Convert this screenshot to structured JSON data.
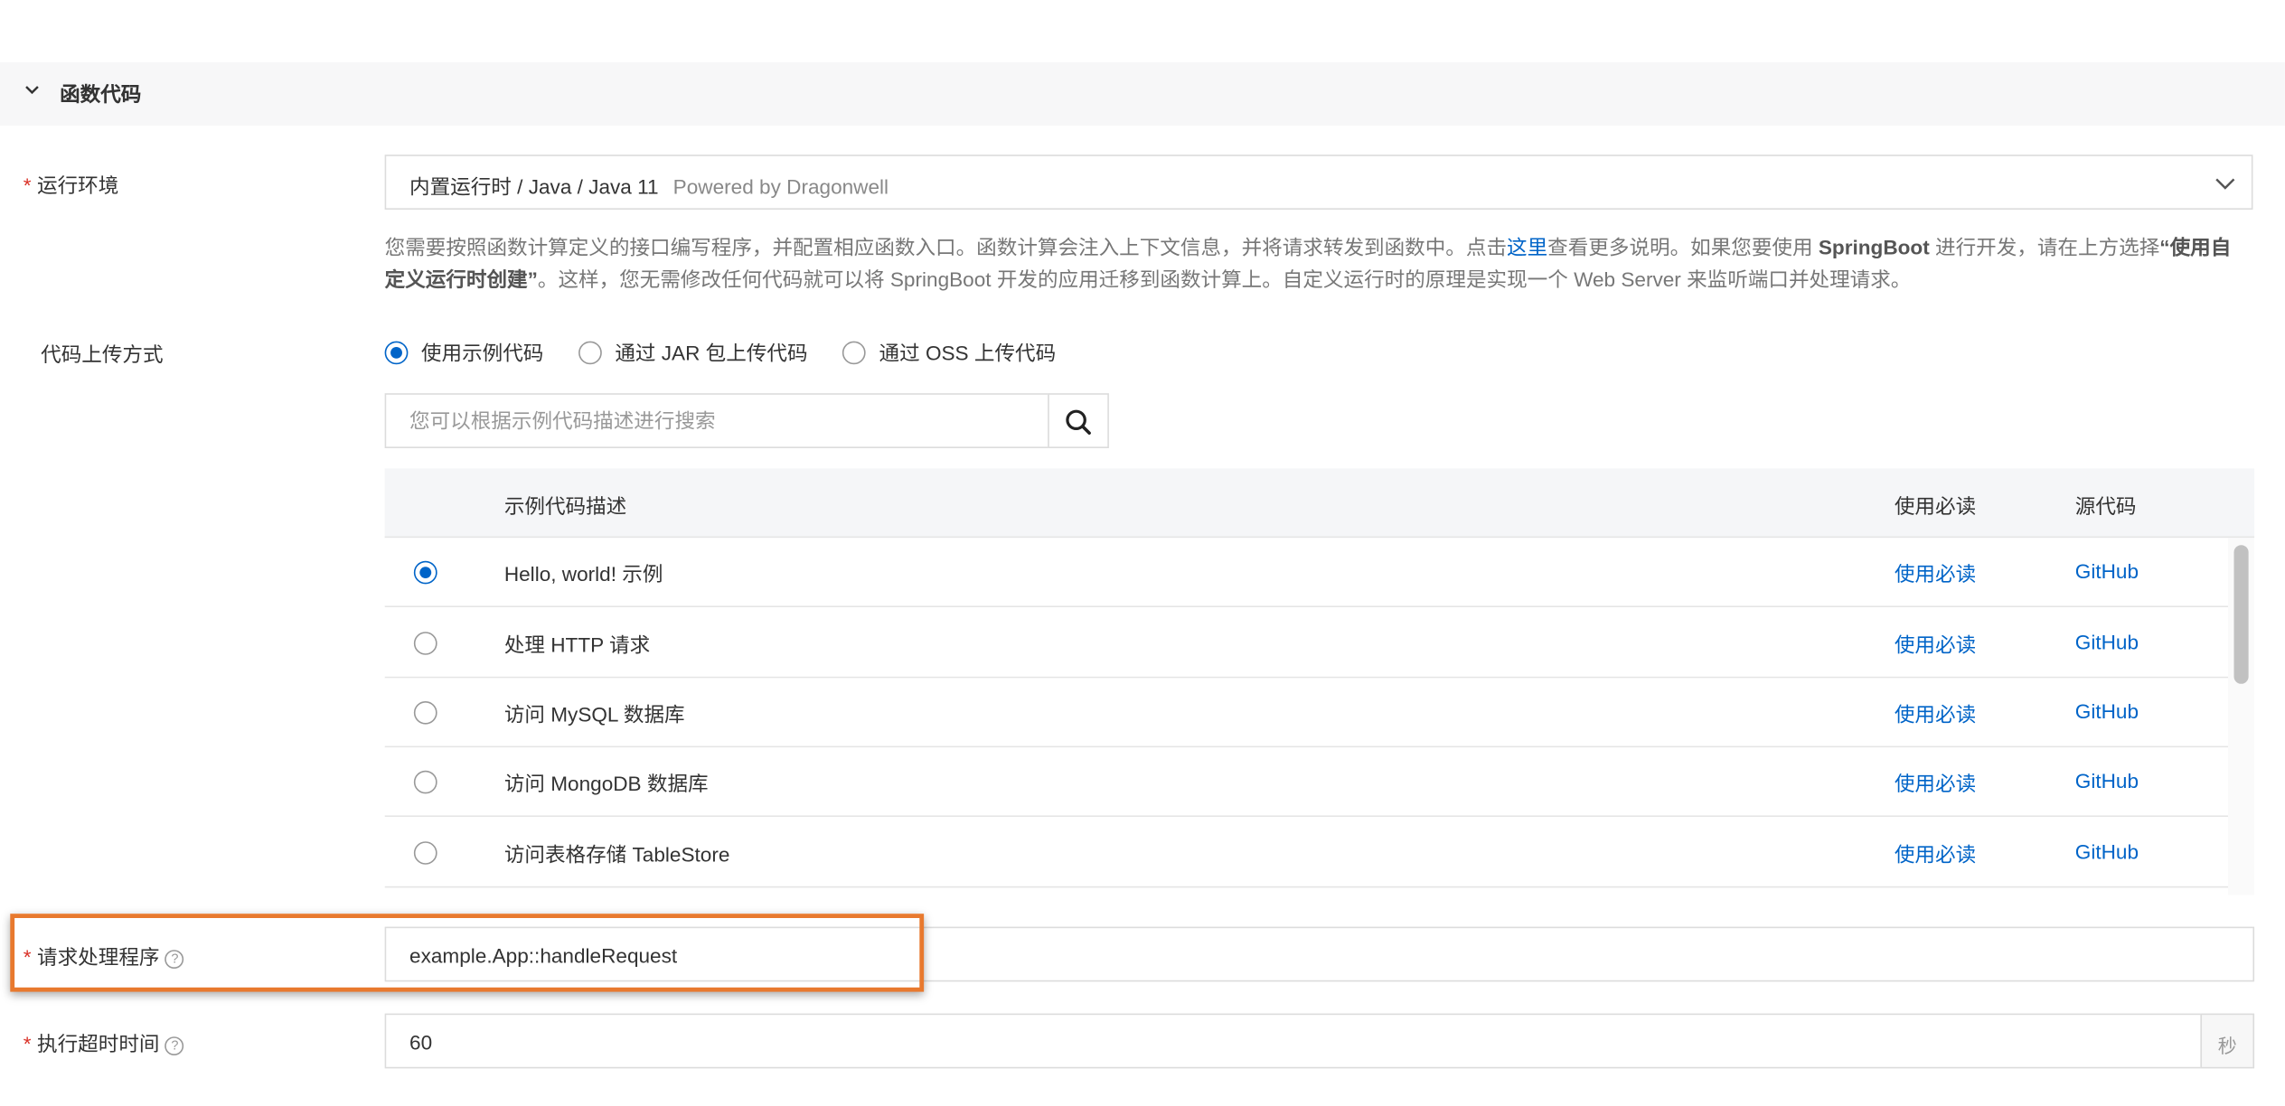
{
  "section": {
    "title": "函数代码",
    "collapse_icon": "chevron-down-icon"
  },
  "runtime": {
    "label": "运行环境",
    "value": "内置运行时 / Java / Java 11",
    "value_sub": "Powered by Dragonwell",
    "dropdown_icon": "chevron-down-icon"
  },
  "description": {
    "part1": "您需要按照函数计算定义的接口编写程序，并配置相应函数入口。函数计算会注入上下文信息，并将请求转发到函数中。点击",
    "link": "这里",
    "part2": "查看更多说明。如果您要使用 ",
    "bold1": "SpringBoot",
    "part3": " 进行开发，请在上方选择",
    "bold2": "“使用自定义运行时创建”",
    "part4": "。这样，您无需修改任何代码就可以将 SpringBoot 开发的应用迁移到函数计算上。自定义运行时的原理是实现一个 Web Server 来监听端口并处理请求。"
  },
  "upload": {
    "label": "代码上传方式",
    "options": [
      "使用示例代码",
      "通过 JAR 包上传代码",
      "通过 OSS 上传代码"
    ],
    "selected_index": 0
  },
  "search": {
    "placeholder": "您可以根据示例代码描述进行搜索",
    "icon": "search-icon"
  },
  "table": {
    "headers": {
      "description": "示例代码描述",
      "readme": "使用必读",
      "source": "源代码"
    },
    "rows": [
      {
        "description": "Hello, world! 示例",
        "readme": "使用必读",
        "source": "GitHub",
        "selected": true
      },
      {
        "description": "处理 HTTP 请求",
        "readme": "使用必读",
        "source": "GitHub",
        "selected": false
      },
      {
        "description": "访问 MySQL 数据库",
        "readme": "使用必读",
        "source": "GitHub",
        "selected": false
      },
      {
        "description": "访问 MongoDB 数据库",
        "readme": "使用必读",
        "source": "GitHub",
        "selected": false
      },
      {
        "description": "访问表格存储 TableStore",
        "readme": "使用必读",
        "source": "GitHub",
        "selected": false
      }
    ]
  },
  "handler": {
    "label": "请求处理程序",
    "value": "example.App::handleRequest",
    "help_icon": "help-icon"
  },
  "timeout": {
    "label": "执行超时时间",
    "value": "60",
    "unit": "秒",
    "help_icon": "help-icon"
  },
  "colors": {
    "accent": "#0064c8",
    "required": "#d93026",
    "highlight": "#e8792e"
  }
}
